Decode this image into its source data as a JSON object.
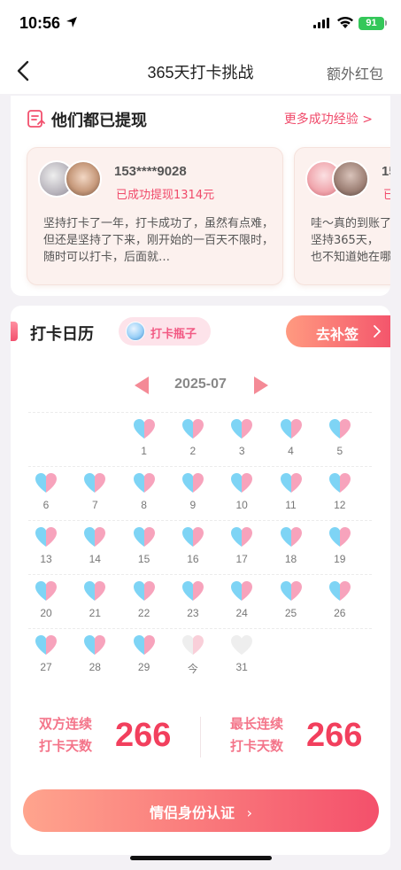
{
  "status_bar": {
    "time": "10:56",
    "battery": "91"
  },
  "nav": {
    "title": "365天打卡挑战",
    "right_label": "额外红包"
  },
  "success_section": {
    "title": "他们都已提现",
    "more_label": "更多成功经验 >",
    "stories": [
      {
        "name": "153****9028",
        "status": "已成功提现1314元",
        "text": "坚持打卡了一年，打卡成功了，虽然有点难，但还是坚持了下来，刚开始的一百天不限时，随时可以打卡，后面就…"
      },
      {
        "name": "15",
        "status": "已",
        "text": "哇～真的到账了\n坚持365天，\n也不知道她在哪"
      }
    ]
  },
  "calendar": {
    "title": "打卡日历",
    "bottle_label": "打卡瓶子",
    "makeup_label": "去补签",
    "month": "2025-07",
    "days": [
      {
        "label": "1",
        "state": "done"
      },
      {
        "label": "2",
        "state": "done"
      },
      {
        "label": "3",
        "state": "done"
      },
      {
        "label": "4",
        "state": "done"
      },
      {
        "label": "5",
        "state": "done"
      },
      {
        "label": "6",
        "state": "done"
      },
      {
        "label": "7",
        "state": "done"
      },
      {
        "label": "8",
        "state": "done"
      },
      {
        "label": "9",
        "state": "done"
      },
      {
        "label": "10",
        "state": "done"
      },
      {
        "label": "11",
        "state": "done"
      },
      {
        "label": "12",
        "state": "done"
      },
      {
        "label": "13",
        "state": "done"
      },
      {
        "label": "14",
        "state": "done"
      },
      {
        "label": "15",
        "state": "done"
      },
      {
        "label": "16",
        "state": "done"
      },
      {
        "label": "17",
        "state": "done"
      },
      {
        "label": "18",
        "state": "done"
      },
      {
        "label": "19",
        "state": "done"
      },
      {
        "label": "20",
        "state": "done"
      },
      {
        "label": "21",
        "state": "done"
      },
      {
        "label": "22",
        "state": "done"
      },
      {
        "label": "23",
        "state": "done"
      },
      {
        "label": "24",
        "state": "done"
      },
      {
        "label": "25",
        "state": "done"
      },
      {
        "label": "26",
        "state": "done"
      },
      {
        "label": "27",
        "state": "done"
      },
      {
        "label": "28",
        "state": "done"
      },
      {
        "label": "29",
        "state": "done"
      },
      {
        "label": "今",
        "state": "partial"
      },
      {
        "label": "31",
        "state": "empty"
      }
    ]
  },
  "stats": {
    "mutual_label_1": "双方连续",
    "mutual_label_2": "打卡天数",
    "mutual_value": "266",
    "longest_label_1": "最长连续",
    "longest_label_2": "打卡天数",
    "longest_value": "266"
  },
  "verify_label": "情侣身份认证",
  "colors": {
    "accent": "#f23f5d",
    "heart_blue": "#7ed4f5",
    "heart_pink": "#f7a3bc",
    "heart_empty": "#eeeeee"
  }
}
